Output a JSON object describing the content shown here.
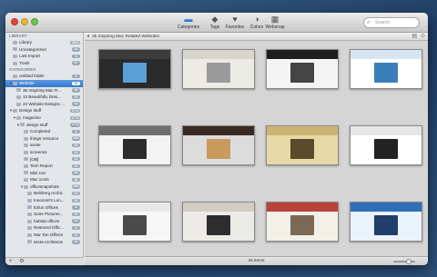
{
  "toolbar": {
    "buttons": [
      {
        "label": "Categories",
        "icon": "folder-icon",
        "glyph": "▬"
      },
      {
        "label": "Tags",
        "icon": "tag-icon",
        "glyph": "◆"
      },
      {
        "label": "Favorites",
        "icon": "heart-icon",
        "glyph": "♥"
      },
      {
        "label": "Colors",
        "icon": "colors-icon",
        "glyph": "◑"
      },
      {
        "label": "Websnap",
        "icon": "websnap-icon",
        "glyph": "▦"
      }
    ],
    "search_placeholder": "Search"
  },
  "sidebar": {
    "library_header": "LIBRARY",
    "library": [
      {
        "label": "Library",
        "count": "1844"
      },
      {
        "label": "Uncategorized",
        "count": "14"
      },
      {
        "label": "Last Import",
        "count": "3"
      },
      {
        "label": "Trash",
        "count": "67"
      }
    ],
    "categories_header": "CATEGORIES",
    "categories": [
      {
        "label": "untitled folder",
        "count": "3",
        "indent": 0,
        "arrow": ""
      },
      {
        "label": "Website",
        "count": "70",
        "indent": 0,
        "arrow": "▼",
        "selected": true
      },
      {
        "label": "35 Inspiring Mac R...",
        "count": "35",
        "indent": 1,
        "arrow": ""
      },
      {
        "label": "13 Beautifully Desi...",
        "count": "13",
        "indent": 1,
        "arrow": ""
      },
      {
        "label": "22 Website Designs ...",
        "count": "22",
        "indent": 1,
        "arrow": ""
      },
      {
        "label": "Design stuff",
        "count": "1774",
        "indent": 0,
        "arrow": "▼"
      },
      {
        "label": "magazine",
        "count": "1774",
        "indent": 1,
        "arrow": "▼"
      },
      {
        "label": "design stuff",
        "count": "1774",
        "indent": 2,
        "arrow": "▼"
      },
      {
        "label": "Completed",
        "count": "9",
        "indent": 3,
        "arrow": ""
      },
      {
        "label": "things resource",
        "count": "293",
        "indent": 3,
        "arrow": ""
      },
      {
        "label": "anote",
        "count": "29",
        "indent": 3,
        "arrow": ""
      },
      {
        "label": "screenss",
        "count": "10",
        "indent": 3,
        "arrow": ""
      },
      {
        "label": "[OB]",
        "count": "14",
        "indent": 3,
        "arrow": ""
      },
      {
        "label": "Tech Report",
        "count": "14",
        "indent": 3,
        "arrow": ""
      },
      {
        "label": "Mini Car",
        "count": "28",
        "indent": 3,
        "arrow": ""
      },
      {
        "label": "Mac icons",
        "count": "28",
        "indent": 3,
        "arrow": ""
      },
      {
        "label": "officesnapshots",
        "count": "383",
        "indent": 3,
        "arrow": "▼"
      },
      {
        "label": "Belzberg Archit...",
        "count": "10",
        "indent": 4,
        "arrow": ""
      },
      {
        "label": "Innocent's Lon...",
        "count": "10",
        "indent": 4,
        "arrow": ""
      },
      {
        "label": "Ezlun Offices",
        "count": "8",
        "indent": 4,
        "arrow": ""
      },
      {
        "label": "Sone Pictures...",
        "count": "10",
        "indent": 4,
        "arrow": ""
      },
      {
        "label": "habitat offices",
        "count": "10",
        "indent": 4,
        "arrow": ""
      },
      {
        "label": "Restored Offic...",
        "count": "11",
        "indent": 4,
        "arrow": ""
      },
      {
        "label": "Mar Tan Offices",
        "count": "14",
        "indent": 4,
        "arrow": ""
      },
      {
        "label": "MAM Architects",
        "count": "10",
        "indent": 4,
        "arrow": ""
      }
    ],
    "footer_add": "+",
    "footer_gear": "⚙"
  },
  "main": {
    "path_title": "35 Inspiring Mac Related Websites",
    "status": "35 items"
  },
  "thumbnails": [
    {
      "name": "thumb-1",
      "bg": "#2a2a2a",
      "band": "#3c3c3c",
      "dev": "#5aa0d8"
    },
    {
      "name": "thumb-2",
      "bg": "#ecebe4",
      "band": "#d8d6cc",
      "dev": "#9a9a9a"
    },
    {
      "name": "thumb-3",
      "bg": "#f4f4f4",
      "band": "#1e1e1e",
      "dev": "#444444"
    },
    {
      "name": "thumb-4",
      "bg": "#ffffff",
      "band": "#d7e6f2",
      "dev": "#3a7fb8"
    },
    {
      "name": "thumb-5",
      "bg": "#f3f3f3",
      "band": "#6f6f6f",
      "dev": "#2c2c2c"
    },
    {
      "name": "thumb-6",
      "bg": "#dcdcdc",
      "band": "#3a2b22",
      "dev": "#c99a5b"
    },
    {
      "name": "thumb-7",
      "bg": "#e9d9a6",
      "band": "#cdb374",
      "dev": "#5d4a2a"
    },
    {
      "name": "thumb-8",
      "bg": "#ffffff",
      "band": "#e6e6e6",
      "dev": "#222222"
    },
    {
      "name": "thumb-9",
      "bg": "#f6f6f6",
      "band": "#e8e8e8",
      "dev": "#4a4a4a"
    },
    {
      "name": "thumb-10",
      "bg": "#edebe6",
      "band": "#d1cdc3",
      "dev": "#2d2d2d"
    },
    {
      "name": "thumb-11",
      "bg": "#f3f0e8",
      "band": "#b9423a",
      "dev": "#7a6a55"
    },
    {
      "name": "thumb-12",
      "bg": "#eaf2fb",
      "band": "#2f6fb8",
      "dev": "#1f3f6a"
    }
  ]
}
